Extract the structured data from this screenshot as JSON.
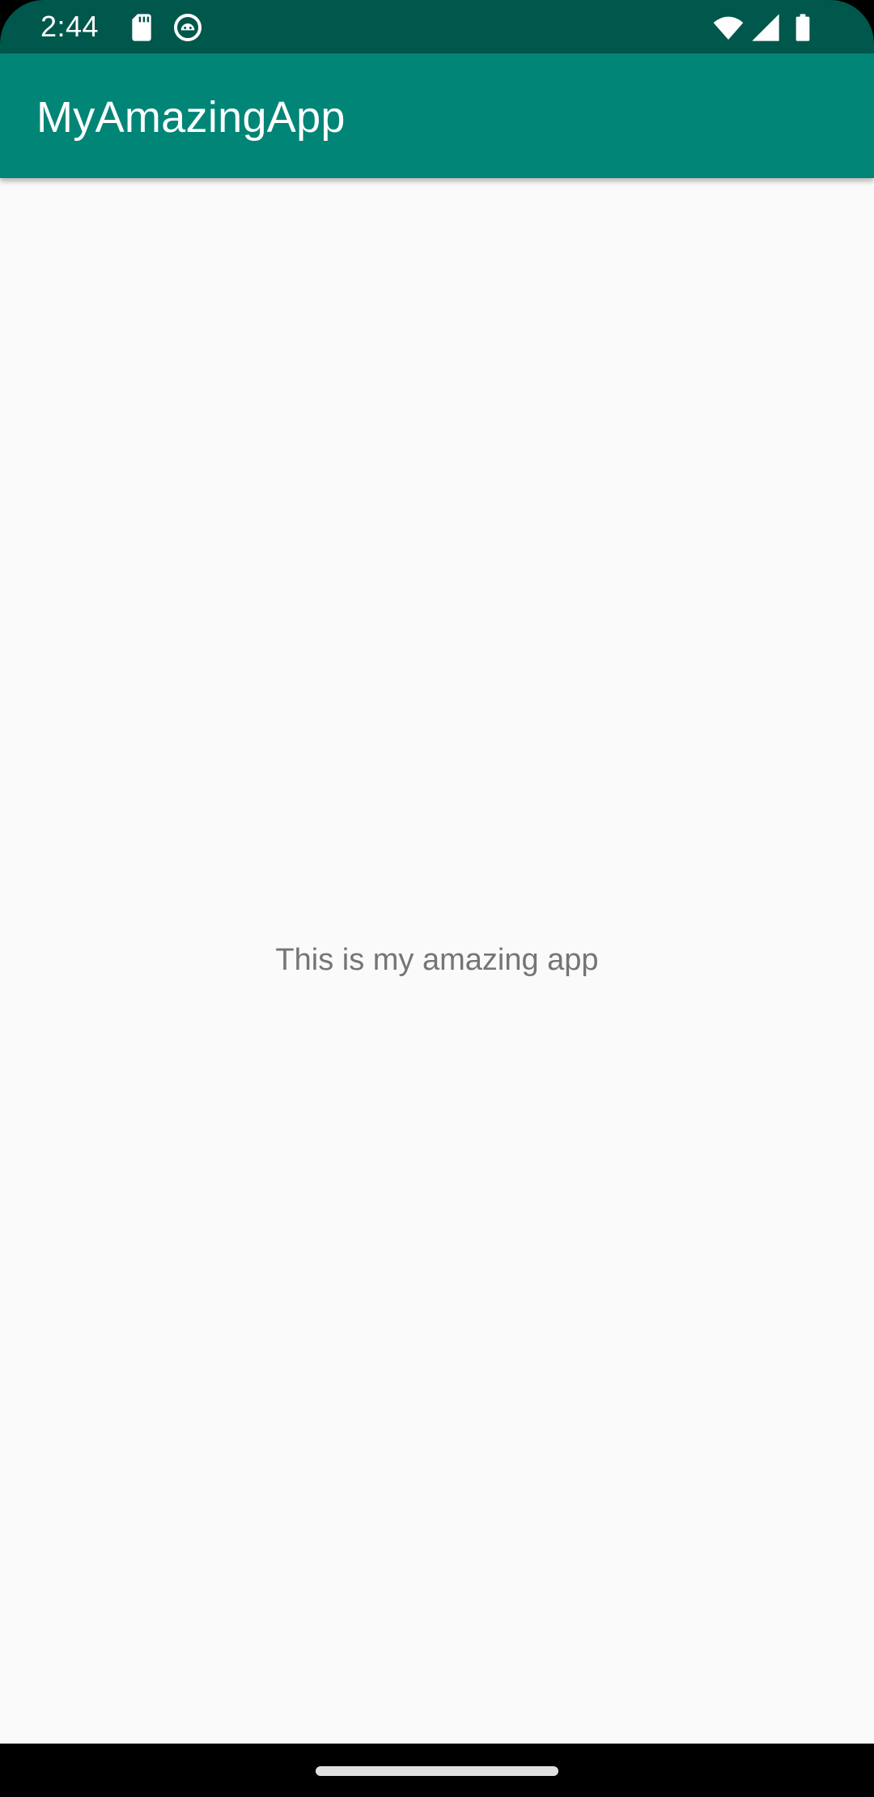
{
  "status_bar": {
    "time": "2:44",
    "icons": [
      "sd-card-icon",
      "android-debug-icon",
      "wifi-icon",
      "cellular-signal-icon",
      "battery-icon"
    ],
    "background": "#00574b"
  },
  "app_bar": {
    "title": "MyAmazingApp",
    "background": "#008577"
  },
  "main": {
    "message": "This is my amazing app",
    "background": "#fafafa",
    "text_color": "#757575"
  },
  "nav_bar": {
    "handle_color": "#e0e0e0"
  }
}
